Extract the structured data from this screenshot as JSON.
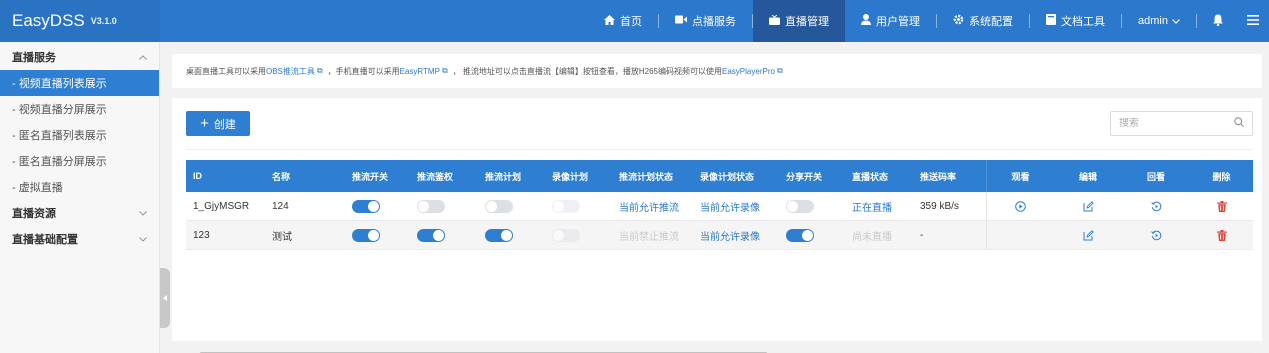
{
  "brand": {
    "name": "EasyDSS",
    "version": "V3.1.0"
  },
  "nav": {
    "home": "首页",
    "vod": "点播服务",
    "live": "直播管理",
    "users": "用户管理",
    "system": "系统配置",
    "docs": "文档工具",
    "user": "admin"
  },
  "sidebar": {
    "groups": [
      {
        "label": "直播服务",
        "chevron": "up",
        "items": [
          "- 视频直播列表展示",
          "- 视频直播分屏展示",
          "- 匿名直播列表展示",
          "- 匿名直播分屏展示",
          "- 虚拟直播"
        ]
      },
      {
        "label": "直播资源",
        "chevron": "down"
      },
      {
        "label": "直播基础配置",
        "chevron": "down"
      }
    ],
    "active_item": "- 视频直播列表展示"
  },
  "notice": {
    "t1": "桌面直播工具可以采用",
    "l1": "OBS推流工具",
    "t2": "，手机直播可以采用",
    "l2": "EasyRTMP",
    "t3": "，  推流地址可以点击直播流【编辑】按钮查看，播放H265编码视频可以使用",
    "l3": "EasyPlayerPro"
  },
  "toolbar": {
    "create_label": "创建",
    "search_placeholder": "搜索"
  },
  "table": {
    "columns": [
      "ID",
      "名称",
      "推流开关",
      "推流鉴权",
      "推流计划",
      "录像计划",
      "推流计划状态",
      "录像计划状态",
      "分享开关",
      "直播状态",
      "推送码率",
      "观看",
      "编辑",
      "回看",
      "删除"
    ],
    "rows": [
      {
        "id": "1_GjyMSGR",
        "name": "124",
        "push_switch": true,
        "push_auth": false,
        "push_plan": false,
        "record_plan": false,
        "push_plan_status": "当前允许推流",
        "push_plan_status_muted": false,
        "record_plan_status": "当前允许录像",
        "share_switch": false,
        "live_status": "正在直播",
        "live_status_muted": false,
        "bitrate": "359 kB/s",
        "has_watch": true
      },
      {
        "id": "123",
        "name": "测试",
        "push_switch": true,
        "push_auth": true,
        "push_plan": true,
        "record_plan": false,
        "push_plan_status": "当前禁止推流",
        "push_plan_status_muted": true,
        "record_plan_status": "当前允许录像",
        "share_switch": true,
        "live_status": "尚未直播",
        "live_status_muted": true,
        "bitrate": "-",
        "has_watch": false
      }
    ]
  },
  "colors": {
    "primary": "#2e7ed1",
    "topbar": "#2b78cd",
    "delete": "#e0453a"
  },
  "icons": {
    "home": "home-icon",
    "vod": "video-icon",
    "live": "tv-icon",
    "users": "user-icon",
    "system": "gear-icon",
    "docs": "book-icon",
    "bell": "bell-icon",
    "menu": "menu-icon",
    "watch": "play-circle-icon",
    "edit": "edit-icon",
    "replay": "replay-icon",
    "delete": "trash-icon"
  }
}
